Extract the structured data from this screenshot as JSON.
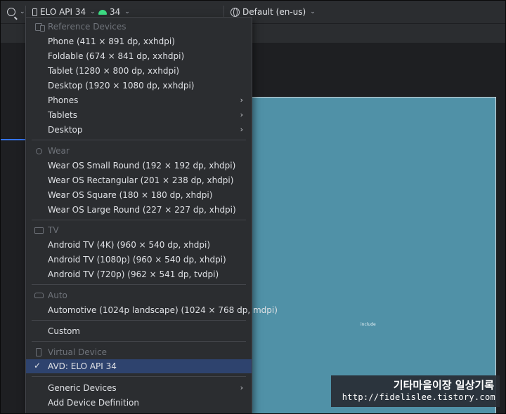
{
  "toolbar": {
    "device_label": "ELO API 34",
    "api_label": "34",
    "locale_label": "Default (en-us)"
  },
  "canvas": {
    "include_label": "include"
  },
  "menu": {
    "reference_header": "Reference Devices",
    "reference_items": [
      "Phone (411 × 891 dp, xxhdpi)",
      "Foldable (674 × 841 dp, xxhdpi)",
      "Tablet (1280 × 800 dp, xxhdpi)",
      "Desktop (1920 × 1080 dp, xxhdpi)"
    ],
    "submenus": [
      "Phones",
      "Tablets",
      "Desktop"
    ],
    "wear_header": "Wear",
    "wear_items": [
      "Wear OS Small Round (192 × 192 dp, xhdpi)",
      "Wear OS Rectangular (201 × 238 dp, xhdpi)",
      "Wear OS Square (180 × 180 dp, xhdpi)",
      "Wear OS Large Round (227 × 227 dp, xhdpi)"
    ],
    "tv_header": "TV",
    "tv_items": [
      "Android TV (4K) (960 × 540 dp, xhdpi)",
      "Android TV (1080p) (960 × 540 dp, xhdpi)",
      "Android TV (720p) (962 × 541 dp, tvdpi)"
    ],
    "auto_header": "Auto",
    "auto_items": [
      "Automotive (1024p landscape) (1024 × 768 dp, mdpi)"
    ],
    "custom_label": "Custom",
    "virtual_header": "Virtual Device",
    "selected_avd": "AVD: ELO API 34",
    "generic_devices": "Generic Devices",
    "add_definition": "Add Device Definition"
  },
  "watermark": {
    "title": "기타마을이장 일상기록",
    "url": "http://fidelislee.tistory.com"
  },
  "colors": {
    "background": "#2b2d30",
    "selection": "#2e436e",
    "device_screen": "#5091a7",
    "android_green": "#3ddc84"
  },
  "icons": [
    "lens-icon",
    "phone-icon",
    "android-icon",
    "globe-icon",
    "devices-icon",
    "watch-icon",
    "tv-icon",
    "car-icon",
    "check-icon",
    "chevron-right-icon"
  ]
}
